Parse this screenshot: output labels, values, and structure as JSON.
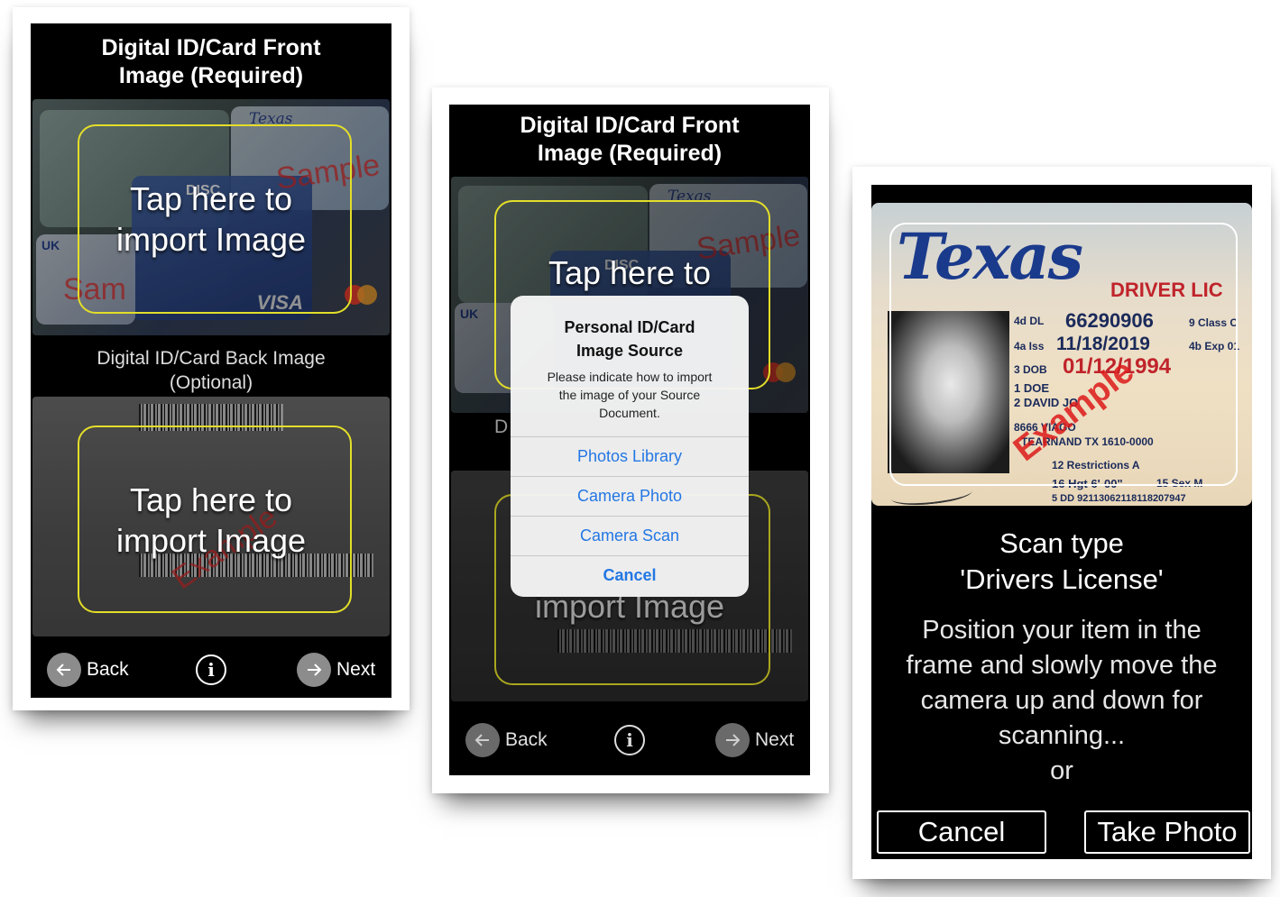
{
  "screen1": {
    "header": {
      "line1": "Digital ID/Card Front",
      "line2": "Image (Required)"
    },
    "front_tap": {
      "line1": "Tap here to",
      "line2": "import Image"
    },
    "back_header": {
      "line1": "Digital ID/Card Back Image",
      "line2": "(Optional)"
    },
    "back_tap": {
      "line1": "Tap here to",
      "line2": "import  Image"
    },
    "front_watermark": "Sample",
    "front_watermark2": "Sam",
    "back_watermark": "Example",
    "sample_texts": {
      "texas": "Texas",
      "disc": "DISC",
      "uk": "UK",
      "visa": "VISA"
    },
    "nav": {
      "back_label": "Back",
      "next_label": "Next",
      "info_glyph": "i"
    }
  },
  "screen2": {
    "header": {
      "line1": "Digital ID/Card Front",
      "line2": "Image (Required)"
    },
    "front_tap": {
      "line1": "Tap here to"
    },
    "back_tap": {
      "line2": "import  Image"
    },
    "back_header_partial": "D",
    "front_watermark": "Sample",
    "sample_texts": {
      "texas": "Texas",
      "disc": "DISC",
      "uk": "UK"
    },
    "dialog": {
      "title_line1": "Personal ID/Card",
      "title_line2": "Image Source",
      "message_line1": "Please indicate how to import",
      "message_line2": "the image of your Source",
      "message_line3": "Document.",
      "options": [
        "Photos Library",
        "Camera Photo",
        "Camera Scan"
      ],
      "cancel": "Cancel"
    },
    "nav": {
      "back_label": "Back",
      "next_label": "Next",
      "info_glyph": "i"
    }
  },
  "screen3": {
    "license": {
      "state": "Texas",
      "type": "DRIVER LIC",
      "dl_label": "4d DL",
      "dl_number": "66290906",
      "iss_label": "4a Iss",
      "iss": "11/18/2019",
      "dob_label": "3 DOB",
      "dob": "01/12/1994",
      "doe_label": "1 DOE",
      "name": "2 DAVID JO",
      "address1": "8666 VIAGO",
      "address2": "TEARNAND TX 1610-0000",
      "restrictions": "12 Restrictions A",
      "height": "16 Hgt 6'-00\"",
      "sex": "15 Sex M",
      "dd": "5 DD 92113062118118207947",
      "class": "9 Class C",
      "exp": "4b Exp 01",
      "watermark": "Example"
    },
    "scan_title": {
      "line1": "Scan type",
      "line2": "'Drivers License'"
    },
    "message": {
      "line1": "Position your item in the",
      "line2": "frame and slowly move the",
      "line3": "camera up and down for",
      "line4": "scanning...",
      "line5": "or"
    },
    "cancel_label": "Cancel",
    "take_photo_label": "Take Photo"
  },
  "colors": {
    "frame_yellow": "#e3de2a",
    "dialog_link": "#2377e4",
    "watermark_red": "#d22828",
    "nav_circle": "#8c8c8c"
  },
  "icons": {
    "back": "arrow-left-icon",
    "next": "arrow-right-icon",
    "info": "info-icon"
  }
}
